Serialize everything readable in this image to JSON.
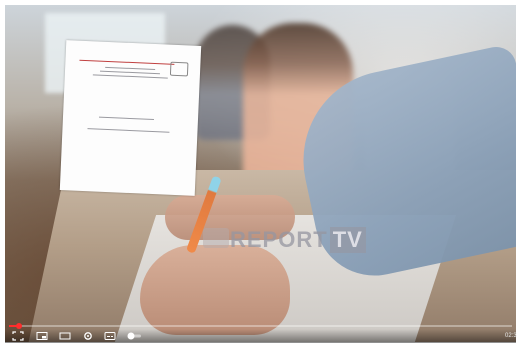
{
  "player": {
    "watermark": {
      "brand_left": "REPORT",
      "brand_badge": "TV"
    },
    "progress": {
      "played_fraction": 0.02
    },
    "time_label": "02:3",
    "controls": [
      {
        "name": "fullscreen-icon"
      },
      {
        "name": "miniplayer-icon"
      },
      {
        "name": "theater-icon"
      },
      {
        "name": "settings-icon"
      },
      {
        "name": "captions-icon"
      },
      {
        "name": "autoplay-toggle"
      }
    ]
  }
}
